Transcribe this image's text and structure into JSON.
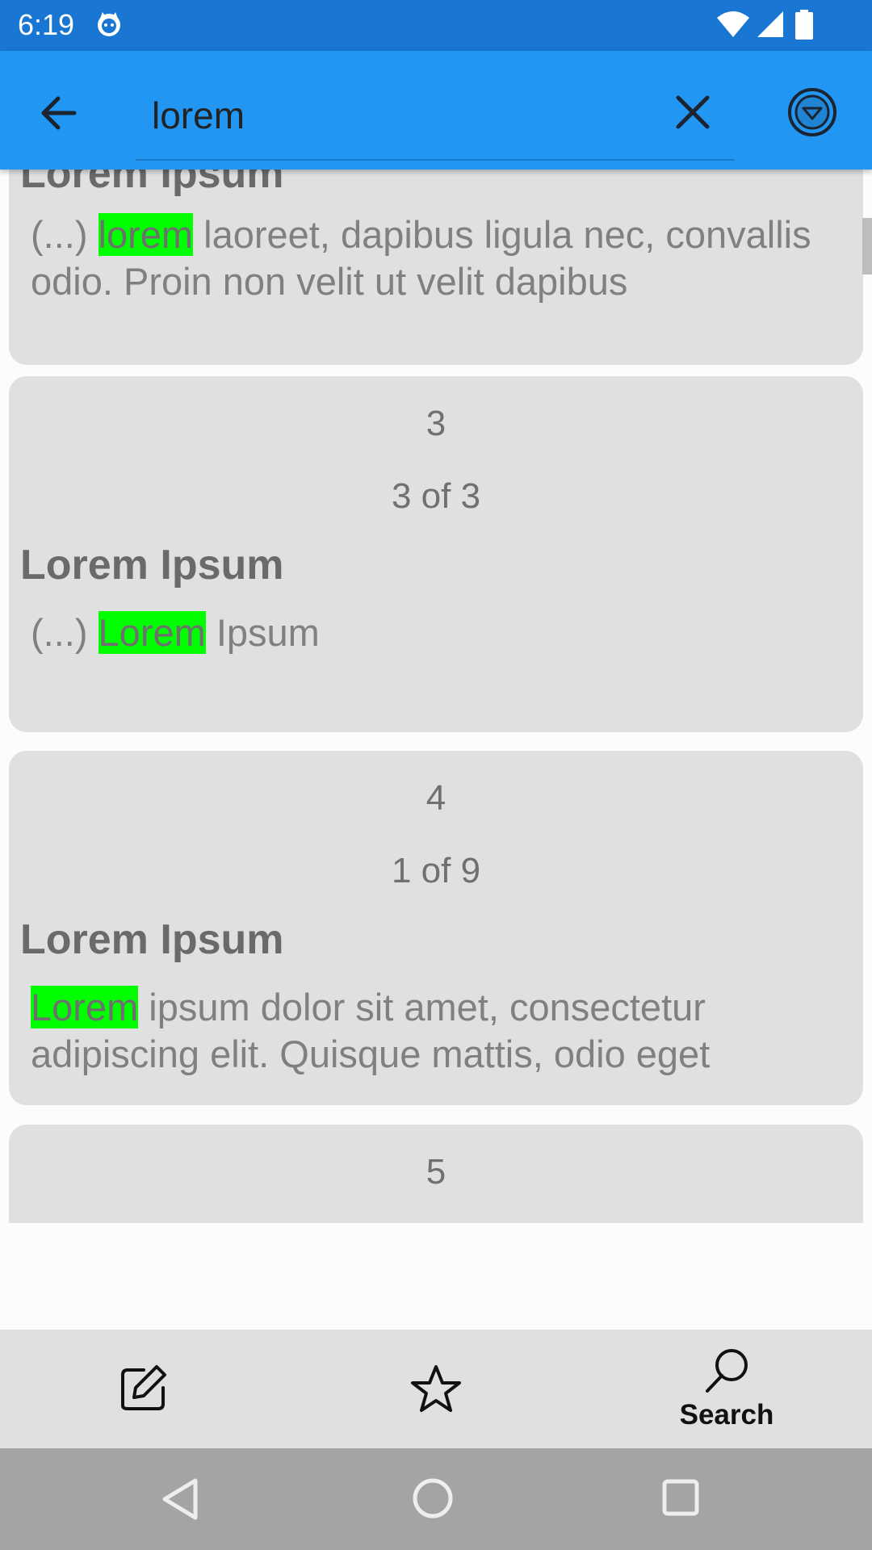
{
  "status_bar": {
    "time": "6:19"
  },
  "app_bar": {
    "search": {
      "value": "lorem",
      "placeholder": ""
    }
  },
  "results": [
    {
      "title": "Lorem Ipsum",
      "snippet_prefix": "(...) ",
      "snippet_highlight": "lorem",
      "snippet_suffix": " laoreet, dapibus ligula nec, convallis odio. Proin non velit ut velit dapibus"
    },
    {
      "number": "3",
      "count": "3 of 3",
      "title": "Lorem Ipsum",
      "snippet_prefix": "(...) ",
      "snippet_highlight": "Lorem",
      "snippet_suffix": " Ipsum"
    },
    {
      "number": "4",
      "count": "1 of 9",
      "title": "Lorem Ipsum",
      "snippet_prefix": "",
      "snippet_highlight": "Lorem",
      "snippet_suffix": " ipsum dolor sit amet, consectetur adipiscing elit. Quisque mattis, odio eget"
    },
    {
      "number": "5"
    }
  ],
  "bottom_nav": {
    "items": [
      {
        "icon": "edit-icon",
        "label": ""
      },
      {
        "icon": "star-icon",
        "label": ""
      },
      {
        "icon": "search-icon",
        "label": "Search"
      }
    ]
  },
  "colors": {
    "status_bar": "#1976d2",
    "app_bar": "#2196f3",
    "highlight": "#00ff00",
    "card": "#e0e0e0",
    "system_nav": "#a4a4a4"
  }
}
